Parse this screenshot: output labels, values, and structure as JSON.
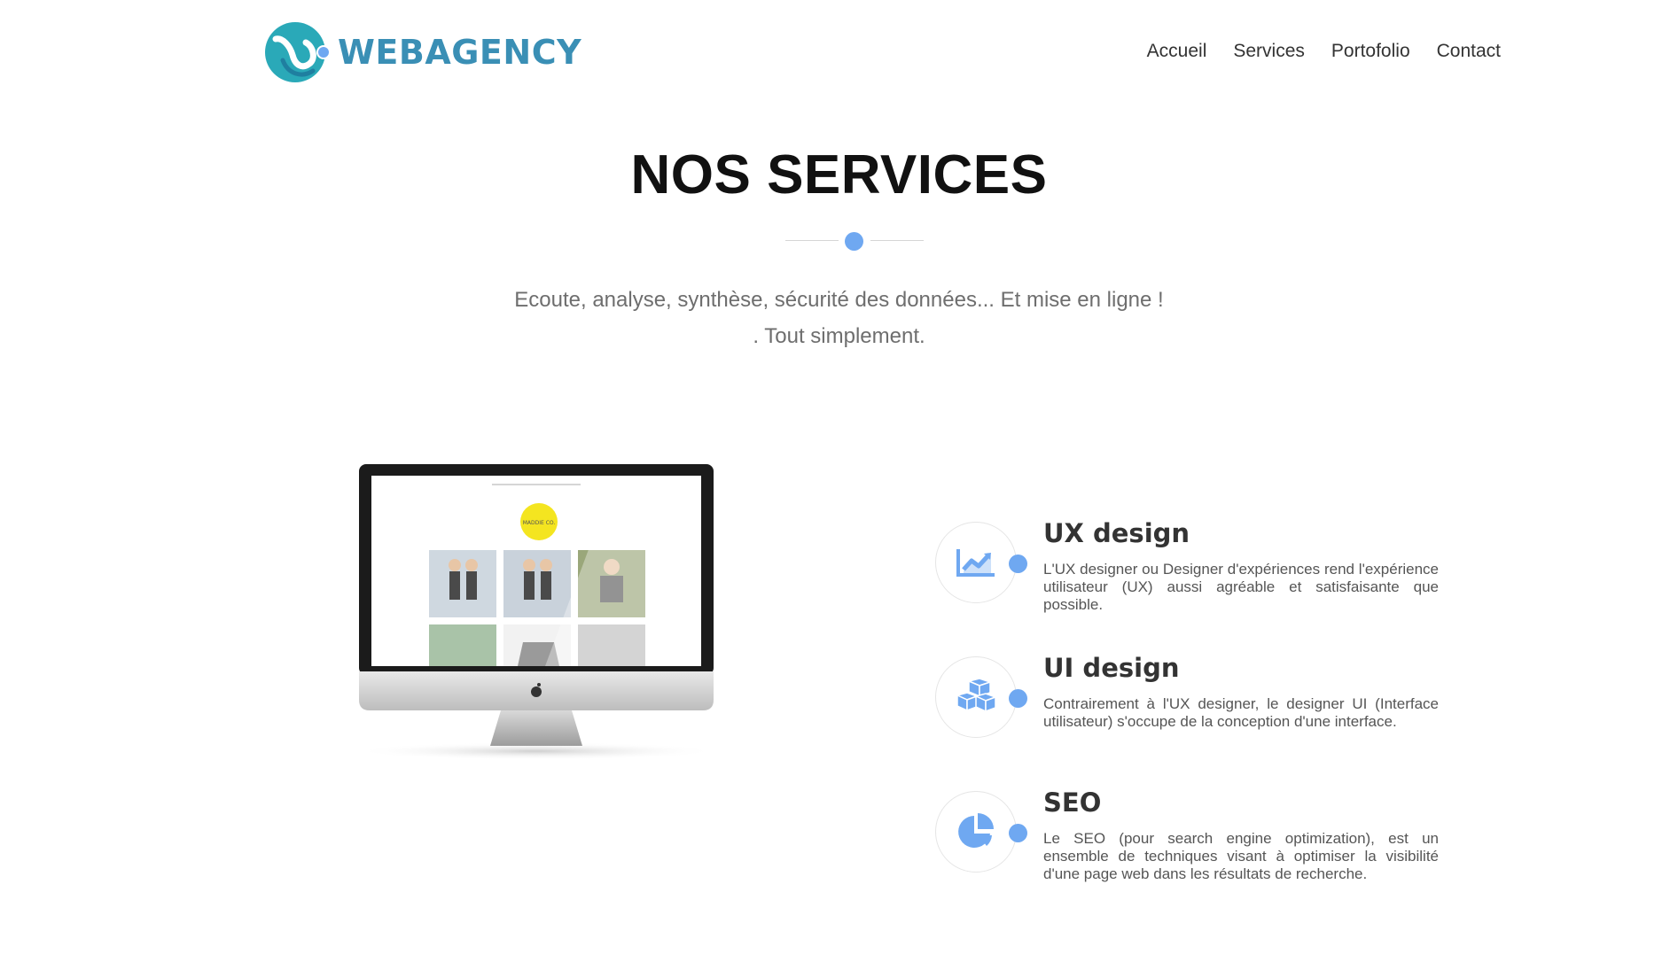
{
  "brand": {
    "name": "WEBAGENCY",
    "color": "#3a8fb5",
    "accent": "#6fa8f1"
  },
  "nav": {
    "items": [
      "Accueil",
      "Services",
      "Portofolio",
      "Contact"
    ]
  },
  "hero": {
    "title": "NOS SERVICES",
    "subtitle_line1": "Ecoute, analyse, synthèse, sécurité des données... Et mise en ligne !",
    "subtitle_line2": ". Tout simplement."
  },
  "monitor": {
    "screen_logo_text": "MADDIE CO."
  },
  "services": [
    {
      "title": "UX design",
      "icon": "chart-line-icon",
      "text": "L'UX designer ou Designer d'expériences rend l'expérience utilisateur (UX) aussi agréable et satisfaisante que possible."
    },
    {
      "title": "UI design",
      "icon": "cubes-icon",
      "text": "Contrairement à l'UX designer, le designer UI (Interface utilisateur) s'occupe de la conception d'une interface."
    },
    {
      "title": "SEO",
      "icon": "pie-chart-icon",
      "text": "Le SEO (pour search engine optimization), est un ensemble de techniques visant à optimiser la visibilité d'une page web dans les résultats de recherche."
    }
  ]
}
